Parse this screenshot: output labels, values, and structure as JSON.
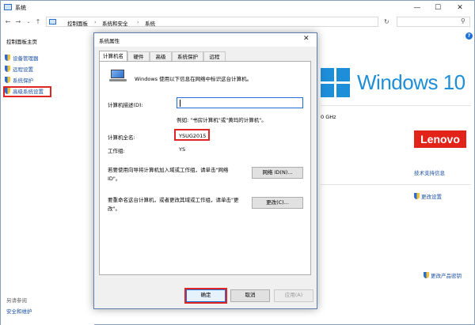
{
  "window": {
    "title": "系统",
    "minimize": "—",
    "maximize": "☐",
    "close": "✕"
  },
  "address": {
    "back": "←",
    "forward": "→",
    "recent": "⌄",
    "up": "↑",
    "crumbs": [
      "控制面板",
      "系统和安全",
      "系统"
    ],
    "separator": "›",
    "refresh": "↻",
    "search_icon": "⚲"
  },
  "sidebar": {
    "home": "控制面板主页",
    "items": [
      {
        "label": "设备管理器"
      },
      {
        "label": "远程设置"
      },
      {
        "label": "系统保护"
      },
      {
        "label": "高级系统设置"
      }
    ],
    "see_also": "另请参阅",
    "security_link": "安全和维护"
  },
  "background": {
    "windows_version": "Windows 10",
    "cpu_suffix": "0 GHz",
    "brand": "Lenovo",
    "support_link": "技术支持信息",
    "change_settings": "更改设置",
    "change_key": "更改产品密钥",
    "help": "?"
  },
  "dialog": {
    "title": "系统属性",
    "close": "✕",
    "tabs": [
      "计算机名",
      "硬件",
      "高级",
      "系统保护",
      "远程"
    ],
    "intro": "Windows 使用以下信息在网络中标识这台计算机。",
    "desc_label": "计算机描述(D):",
    "desc_value": "",
    "example": "例如: \"书房计算机\"或\"黄玛的计算机\"。",
    "fullname_label": "计算机全名:",
    "fullname_value": "YSUG2015",
    "workgroup_label": "工作组:",
    "workgroup_value": "YS",
    "join_text": "若要使用向导将计算机加入域或工作组，请单击\"网络 ID\"。",
    "network_id_button": "网络 ID(N)...",
    "change_text": "要重命名这台计算机，或者更改其域或工作组，请单击\"更改\"。",
    "change_button": "更改(C)...",
    "ok": "确定",
    "cancel": "取消",
    "apply": "应用(A)"
  }
}
